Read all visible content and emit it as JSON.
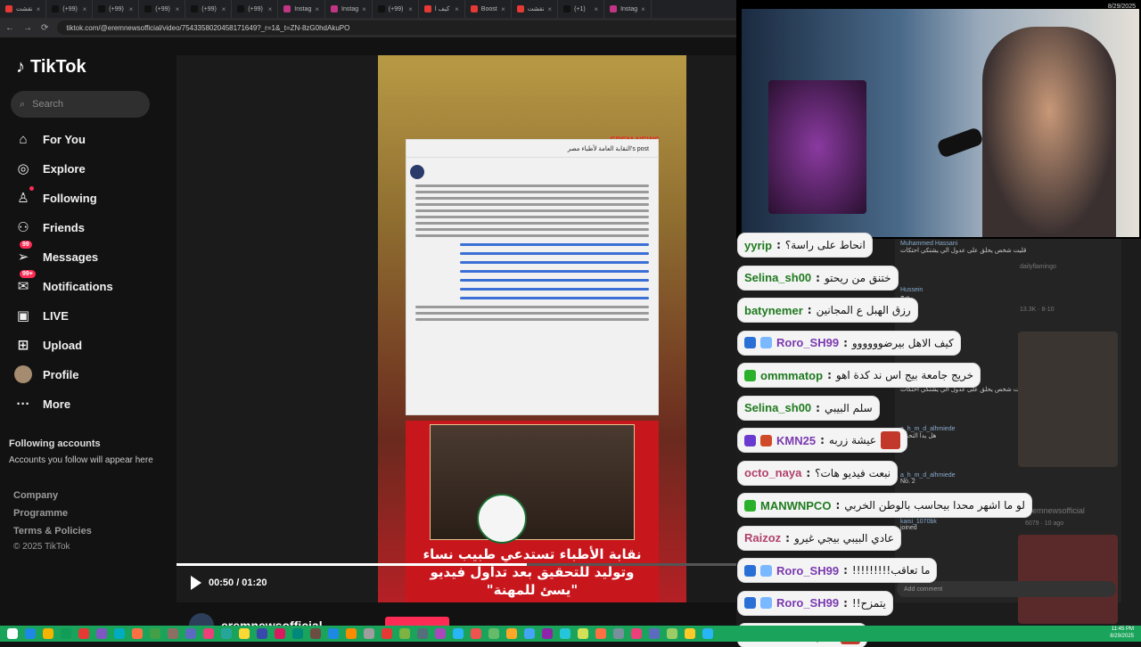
{
  "browser": {
    "tabs": [
      {
        "label": "نقشت",
        "color": "#e53935"
      },
      {
        "label": "(+99)",
        "color": "#111111"
      },
      {
        "label": "(+99)",
        "color": "#111111"
      },
      {
        "label": "(+99)",
        "color": "#111111"
      },
      {
        "label": "(+99)",
        "color": "#111111"
      },
      {
        "label": "(+99)",
        "color": "#111111"
      },
      {
        "label": "Instag",
        "color": "#c13584"
      },
      {
        "label": "Instag",
        "color": "#c13584"
      },
      {
        "label": "(+99)",
        "color": "#111111"
      },
      {
        "label": "كيف ا",
        "color": "#e53935"
      },
      {
        "label": "Boost",
        "color": "#e53935"
      },
      {
        "label": "نقشت",
        "color": "#e53935"
      },
      {
        "label": "(+1)",
        "color": "#111111"
      },
      {
        "label": "Instag",
        "color": "#c13584"
      }
    ],
    "url": "tiktok.com/@eremnewsofficial/video/7543358020458171649?_r=1&_t=ZN-8zG0hdAkuPO"
  },
  "sidebar": {
    "logo": "TikTok",
    "search_placeholder": "Search",
    "items": [
      {
        "label": "For You",
        "icon": "home-icon"
      },
      {
        "label": "Explore",
        "icon": "compass-icon"
      },
      {
        "label": "Following",
        "icon": "following-icon"
      },
      {
        "label": "Friends",
        "icon": "friends-icon"
      },
      {
        "label": "Messages",
        "icon": "messages-icon",
        "badge": "99"
      },
      {
        "label": "Notifications",
        "icon": "bell-icon",
        "badge": "99+"
      },
      {
        "label": "LIVE",
        "icon": "live-icon"
      },
      {
        "label": "Upload",
        "icon": "upload-icon"
      },
      {
        "label": "Profile",
        "icon": "avatar"
      },
      {
        "label": "More",
        "icon": "more-icon"
      }
    ],
    "following_title": "Following accounts",
    "following_sub": "Accounts you follow will appear here",
    "footer": [
      "Company",
      "Programme",
      "Terms & Policies"
    ],
    "copyright": "© 2025 TikTok"
  },
  "player": {
    "time": "00:50 / 01:20",
    "progress": 0.625,
    "channel": "eremnewsofficial",
    "post_header": "النقابة العامة لأطباء مصر's post",
    "watermark": "EREM NEWS",
    "headline": "نقابة الأطباء تستدعي طبيب نساء وتوليد للتحقيق بعد تداول فيديو \"يسئ للمهنة\""
  },
  "chat": [
    {
      "user": "yyrip",
      "text": "انحاط على راسة؟",
      "user_color": "#1f7a1f"
    },
    {
      "user": "Selina_sh00",
      "text": "ختنق من ريحتو",
      "user_color": "#1f7a1f"
    },
    {
      "user": "batynemer",
      "text": "رزق الهبل ع المجانين",
      "user_color": "#1f7a1f"
    },
    {
      "user": "Roro_SH99",
      "text": "كيف الاهل بيرضوووووو",
      "user_color": "#7a3ab0"
    },
    {
      "user": "ommmatop",
      "text": "خريج جامعة بيج اس ند كدة اهو",
      "user_color": "#1f7a1f"
    },
    {
      "user": "Selina_sh00",
      "text": "سلم البيبي",
      "user_color": "#1f7a1f"
    },
    {
      "user": "KMN25",
      "text": "عيشة زربه",
      "user_color": "#7a3ab0"
    },
    {
      "user": "octo_naya",
      "text": "نبعت فيديو هات؟",
      "user_color": "#b0406a"
    },
    {
      "user": "MANWNPCO",
      "text": "لو ما اشهر محدا بيحاسب بالوطن الخربي",
      "user_color": "#1f7a1f"
    },
    {
      "user": "Raizoz",
      "text": "عادي البيبي بيجي غيرو",
      "user_color": "#b0406a"
    },
    {
      "user": "Roro_SH99",
      "text": "!!!!!!!!!ما تعاقب",
      "user_color": "#7a3ab0"
    },
    {
      "user": "Roro_SH99",
      "text": "!!يتمزح",
      "user_color": "#7a3ab0"
    },
    {
      "user": "ommmatop",
      "text": "",
      "user_color": "#1f7a1f"
    }
  ],
  "comments": [
    {
      "user": "Muhammed Hassani",
      "text": "قليت شخص يحلق على عدول الي يشتكي احتكات"
    },
    {
      "user": "Hussein",
      "text": "صح"
    },
    {
      "user": "Hussein",
      "text": "بس لا"
    },
    {
      "user": "Muhammed Hassani",
      "text": "قليت شخص يحلق على عدول الي يشتكي احتكات"
    },
    {
      "user": "a_h_m_d_alhmiede",
      "text": "هل يدا التحدي"
    },
    {
      "user": "a_h_m_d_alhmiede",
      "text": "No. 2"
    },
    {
      "user": "kaisi_1070bk",
      "text": "joined"
    }
  ],
  "add_comment_placeholder": "Add comment",
  "side_labels": {
    "views_1": "13.3K · 8-10",
    "views_2": "6079 · 10 ago",
    "channel_2": "eremnewsofficial",
    "tag_1": "dailyflamingo"
  },
  "clock": {
    "time": "11:45 PM",
    "date": "8/29/2025"
  },
  "colors": {
    "accent": "#fe2c55",
    "taskbar": "#1aa35a"
  }
}
